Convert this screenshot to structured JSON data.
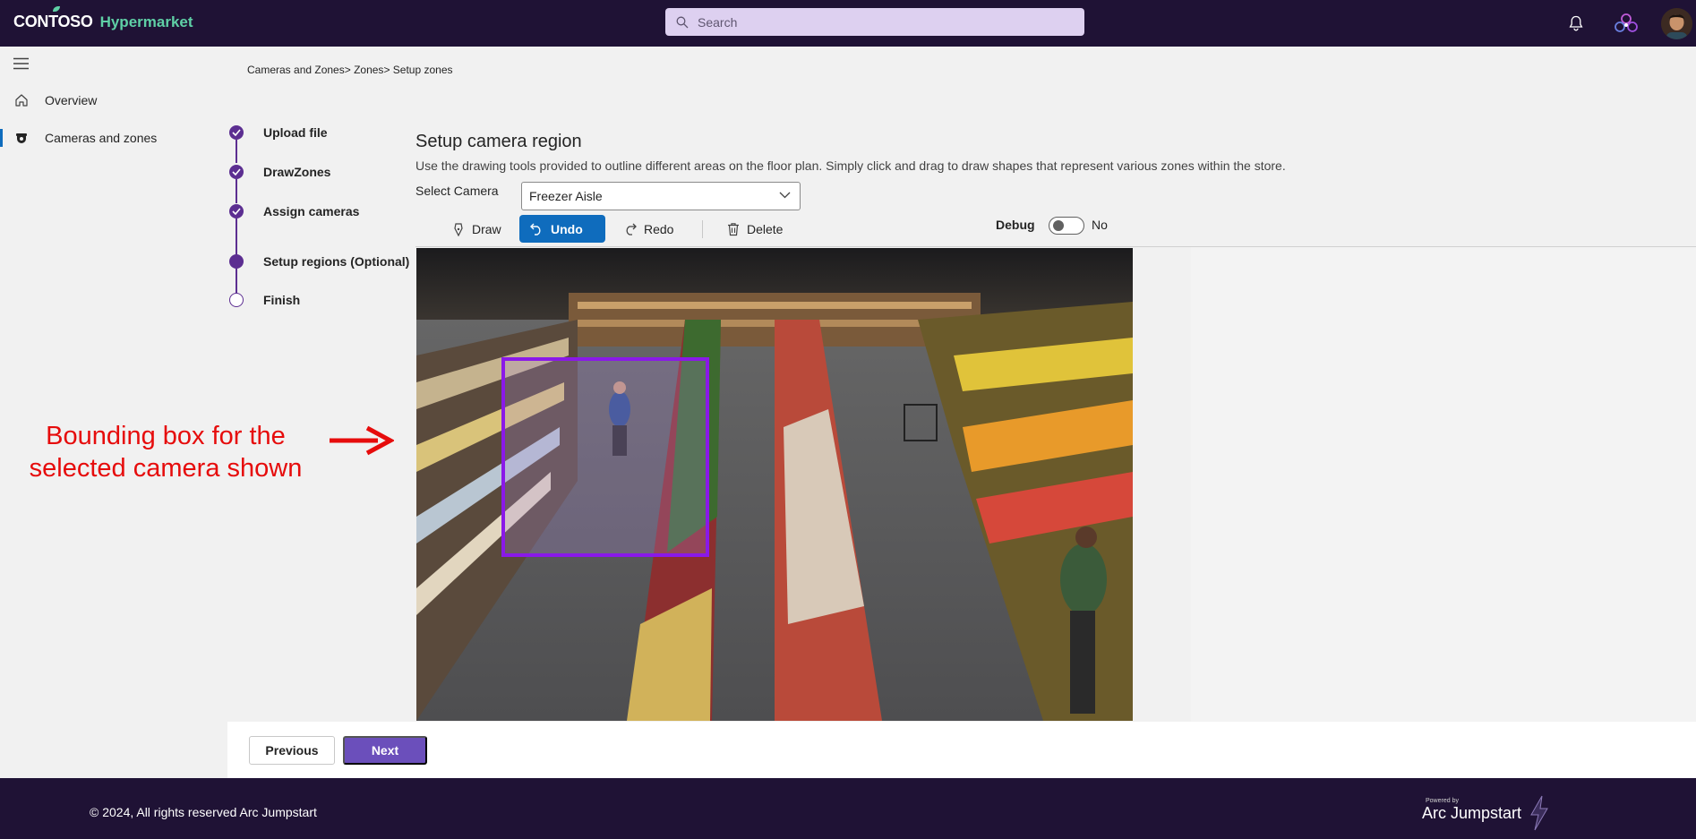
{
  "header": {
    "brand": "CONTOSO",
    "app_name": "Hypermarket",
    "search_placeholder": "Search",
    "icons": [
      "search-icon",
      "bell-icon",
      "copilot-icon",
      "avatar"
    ]
  },
  "sidebar": {
    "items": [
      {
        "label": "Overview",
        "icon": "home-icon"
      },
      {
        "label": "Cameras and zones",
        "icon": "camera-icon",
        "active": true
      }
    ]
  },
  "breadcrumb": {
    "items": [
      "Cameras and Zones",
      "> Zones",
      "> Setup zones"
    ]
  },
  "stepper": {
    "steps": [
      {
        "label": "Upload file",
        "state": "done"
      },
      {
        "label": "DrawZones",
        "state": "done"
      },
      {
        "label": "Assign cameras",
        "state": "done"
      },
      {
        "label": "Setup regions (Optional)",
        "state": "current"
      },
      {
        "label": "Finish",
        "state": "pending"
      }
    ]
  },
  "main": {
    "title": "Setup camera region",
    "description": "Use the drawing tools provided to outline different areas on the floor plan. Simply click and drag to draw shapes that represent various zones within the store.",
    "select_camera_label": "Select Camera",
    "selected_camera": "Freezer Aisle",
    "toolbar": {
      "draw": "Draw",
      "undo": "Undo",
      "redo": "Redo",
      "delete": "Delete"
    },
    "debug_label": "Debug",
    "debug_value": "No"
  },
  "annotation": {
    "line1": "Bounding box for the",
    "line2": "selected camera shown"
  },
  "nav_buttons": {
    "previous": "Previous",
    "next": "Next"
  },
  "footer": {
    "copyright": "© 2024, All rights reserved Arc Jumpstart",
    "powered_by": "Powered by",
    "product": "Arc Jumpstart"
  },
  "colors": {
    "header_bg": "#1f1235",
    "accent_green": "#5fd0a6",
    "step_purple": "#5c2e91",
    "primary_blue": "#0f6cbd",
    "next_purple": "#6b4fbb",
    "bbox_purple": "#8a19e8",
    "annotation_red": "#e60c0c"
  }
}
